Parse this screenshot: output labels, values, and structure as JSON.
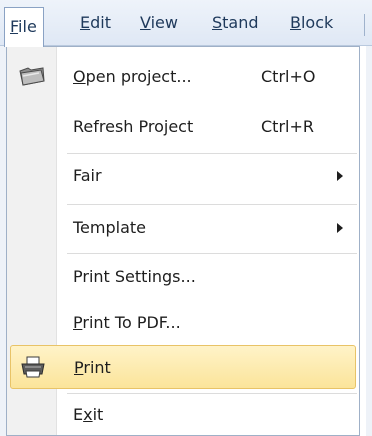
{
  "menubar": {
    "items": [
      {
        "accel": "F",
        "rest": "ile"
      },
      {
        "accel": "E",
        "rest": "dit"
      },
      {
        "accel": "V",
        "rest": "iew"
      },
      {
        "accel": "S",
        "rest": "tand"
      },
      {
        "accel": "B",
        "rest": "lock"
      }
    ]
  },
  "menu": {
    "open_project": {
      "pre": "",
      "accel": "O",
      "rest": "pen project...",
      "shortcut": "Ctrl+O",
      "icon": "folder-open-icon"
    },
    "refresh_project": {
      "label": "Refresh Project",
      "shortcut": "Ctrl+R"
    },
    "fair": {
      "label": "Fair"
    },
    "template": {
      "label": "Template"
    },
    "print_settings": {
      "label": "Print Settings..."
    },
    "print_to_pdf": {
      "pre": "",
      "accel": "P",
      "rest": "rint To PDF..."
    },
    "print": {
      "pre": "",
      "accel": "P",
      "rest": "rint",
      "icon": "printer-icon",
      "highlighted": true
    },
    "exit": {
      "pre": "E",
      "accel": "x",
      "rest": "it"
    }
  },
  "colors": {
    "menubar_text": "#1e395b",
    "highlight_fill": "#fbe49a",
    "highlight_border": "#e8c367",
    "gutter": "#f1f1f1"
  }
}
